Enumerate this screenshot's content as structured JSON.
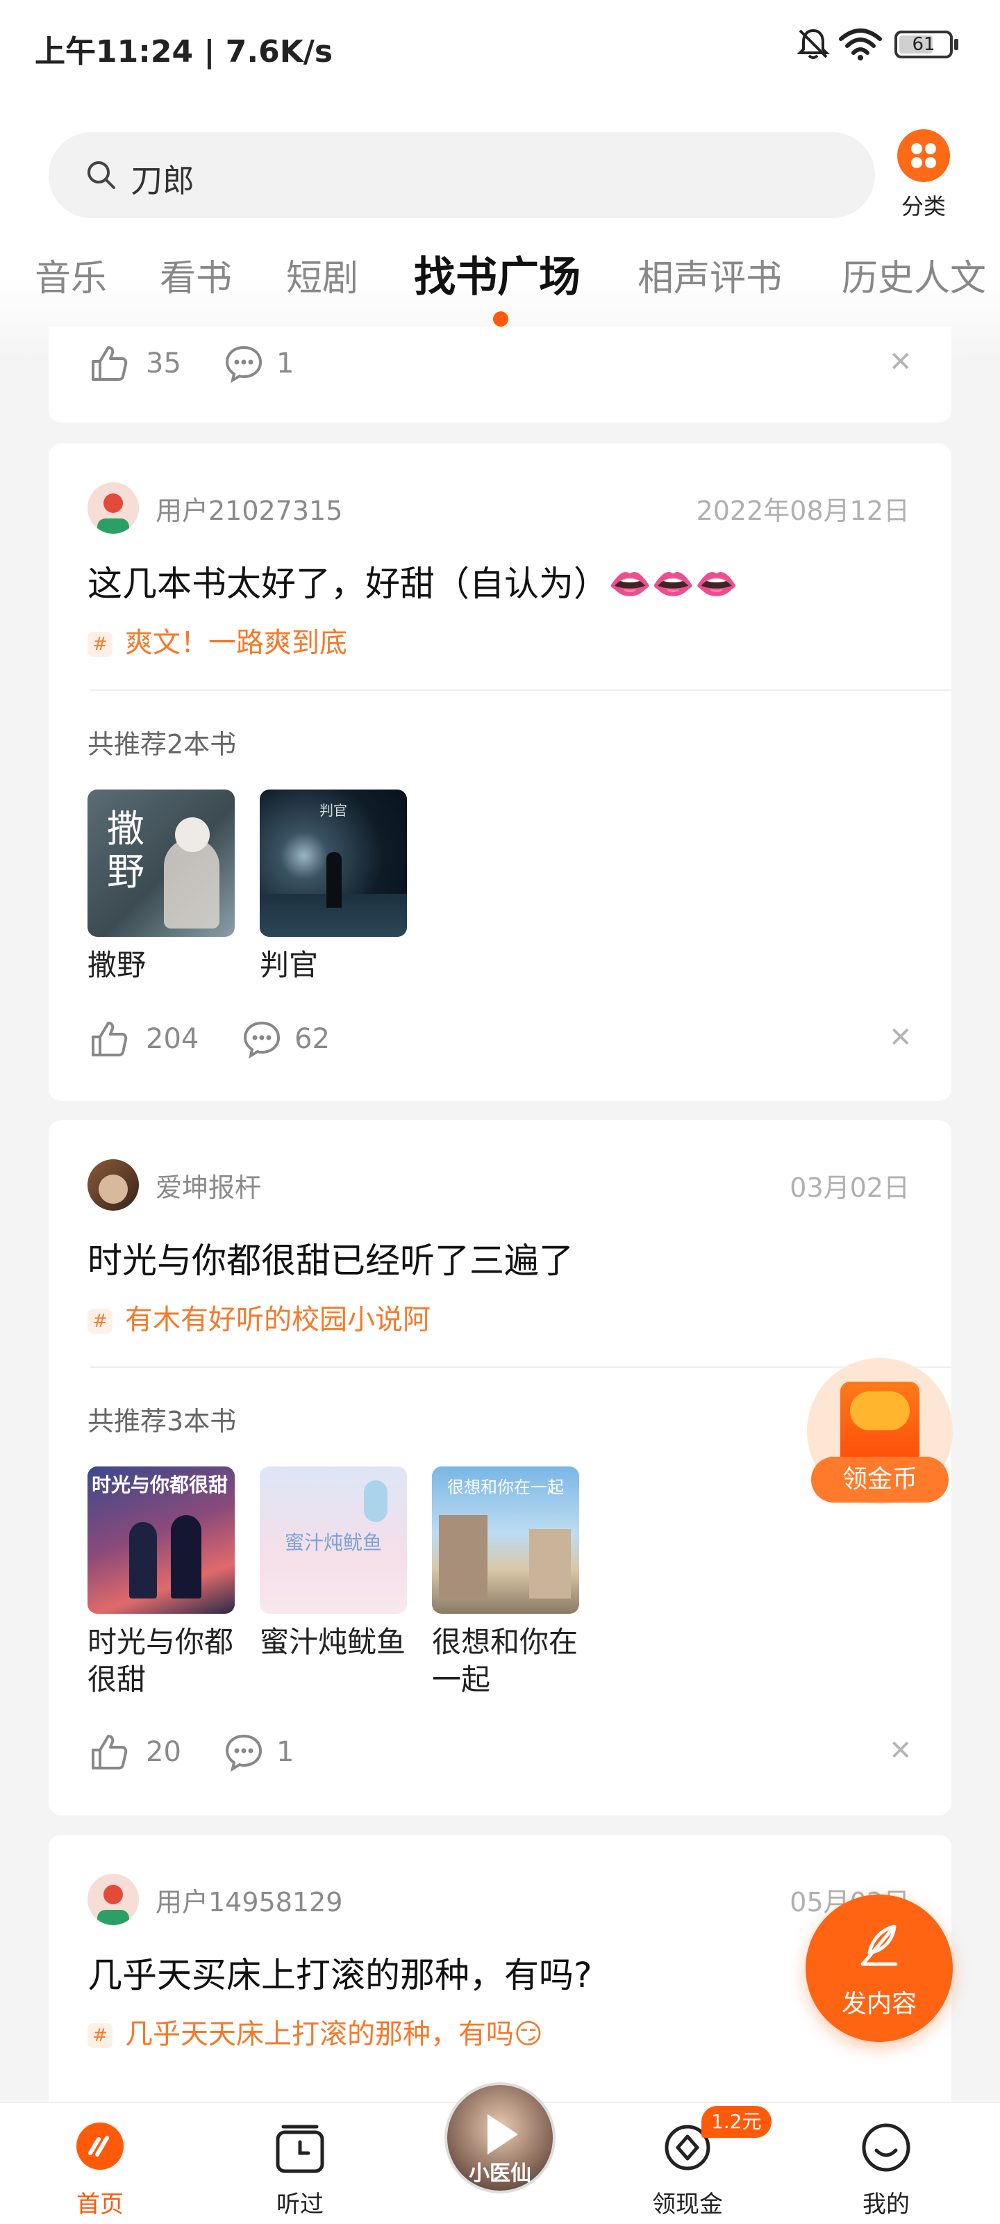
{
  "status_bar": {
    "time": "上午11:24 | 7.6K/s",
    "battery": "61"
  },
  "search": {
    "placeholder": "刀郎"
  },
  "category_button": {
    "label": "分类"
  },
  "tabs": [
    "音乐",
    "看书",
    "短剧",
    "找书广场",
    "相声评书",
    "历史人文"
  ],
  "active_tab": "找书广场",
  "colors": {
    "accent": "#ff5a0a",
    "tag": "#f57a2a"
  },
  "top_card": {
    "likes": "35",
    "comments": "1"
  },
  "posts": [
    {
      "user": "用户21027315",
      "date": "2022年08月12日",
      "title": "这几本书太好了，好甜（自认为）👄👄👄",
      "tag": "爽文！一路爽到底",
      "rec_count": "共推荐2本书",
      "books": [
        {
          "title": "撒野",
          "cover_text": "撒野"
        },
        {
          "title": "判官",
          "cover_text": "判官"
        }
      ],
      "likes": "204",
      "comments": "62"
    },
    {
      "user": "爱坤报杆",
      "date": "03月02日",
      "title": "时光与你都很甜已经听了三遍了",
      "tag": "有木有好听的校园小说阿",
      "rec_count": "共推荐3本书",
      "books": [
        {
          "title": "时光与你都很甜",
          "cover_text": "时光与你都很甜"
        },
        {
          "title": "蜜汁炖鱿鱼",
          "cover_text": "蜜汁炖鱿鱼"
        },
        {
          "title": "很想和你在一起",
          "cover_text": "很想和你在一起"
        }
      ],
      "likes": "20",
      "comments": "1"
    },
    {
      "user": "用户14958129",
      "date": "05月02日",
      "title": "几乎天买床上打滚的那种，有吗?",
      "tag": "几乎天天床上打滚的那种，有吗😏"
    }
  ],
  "floating": {
    "coins": "领金币",
    "post": "发内容"
  },
  "bottom_nav": {
    "home": "首页",
    "history": "听过",
    "player_cover": "小医仙",
    "cash": "领现金",
    "cash_badge": "1.2元",
    "me": "我的"
  }
}
